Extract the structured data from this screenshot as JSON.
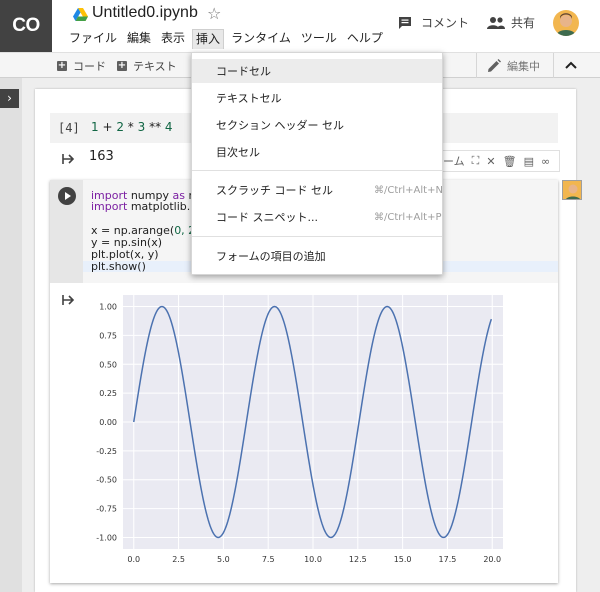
{
  "app": {
    "logo_text": "CO",
    "notebook_title": "Untitled0.ipynb",
    "comment_label": "コメント",
    "share_label": "共有"
  },
  "menubar": [
    "ファイル",
    "編集",
    "表示",
    "挿入",
    "ランタイム",
    "ツール",
    "ヘルプ"
  ],
  "toolbar": {
    "add_code": "コード",
    "add_text": "テキスト",
    "edit_mode": "編集中"
  },
  "insert_menu": {
    "items": [
      {
        "label": "コードセル",
        "shortcut": ""
      },
      {
        "label": "テキストセル",
        "shortcut": ""
      },
      {
        "label": "セクション ヘッダー セル",
        "shortcut": ""
      },
      {
        "label": "目次セル",
        "shortcut": ""
      },
      {
        "label": "スクラッチ コード セル",
        "shortcut": "⌘/Ctrl+Alt+N"
      },
      {
        "label": "コード スニペット...",
        "shortcut": "⌘/Ctrl+Alt+P"
      },
      {
        "label": "フォームの項目の追加",
        "shortcut": ""
      }
    ]
  },
  "cell4": {
    "prompt": "[4]",
    "code": [
      "1",
      " + ",
      "2",
      " * ",
      "3",
      " ** ",
      "4"
    ],
    "output": "163"
  },
  "cell_toolbar": {
    "form_label": "ーム"
  },
  "code_cell": {
    "line1_kw": "import",
    "line1_rest": " numpy ",
    "line1_as": "as",
    "line1_tail": " np",
    "line2_kw": "import",
    "line2_rest": " matplotlib.p",
    "line3_pre": "x = np.arange(",
    "line3_num": "0, 20",
    "line4": "y = np.sin(x)",
    "line5": "plt.plot(x, y)",
    "line6": "plt.show()"
  },
  "chart_data": {
    "type": "line",
    "function": "sin(x)",
    "x_range": [
      0,
      20
    ],
    "xlim": [
      -0.6,
      20.6
    ],
    "ylim": [
      -1.1,
      1.1
    ],
    "xticks": [
      "0.0",
      "2.5",
      "5.0",
      "7.5",
      "10.0",
      "12.5",
      "15.0",
      "17.5",
      "20.0"
    ],
    "yticks": [
      "1.00",
      "0.75",
      "0.50",
      "0.25",
      "0.00",
      "-0.25",
      "-0.50",
      "-0.75",
      "-1.00"
    ],
    "xtick_values": [
      0,
      2.5,
      5,
      7.5,
      10,
      12.5,
      15,
      17.5,
      20
    ],
    "ytick_values": [
      1,
      0.75,
      0.5,
      0.25,
      0,
      -0.25,
      -0.5,
      -0.75,
      -1
    ],
    "line_color": "#4c72b0",
    "background": "#eaeaf2",
    "grid": true
  },
  "colors": {
    "accent_purple": "#7b1fa2",
    "number_green": "#116644",
    "header_dark": "#424242"
  }
}
